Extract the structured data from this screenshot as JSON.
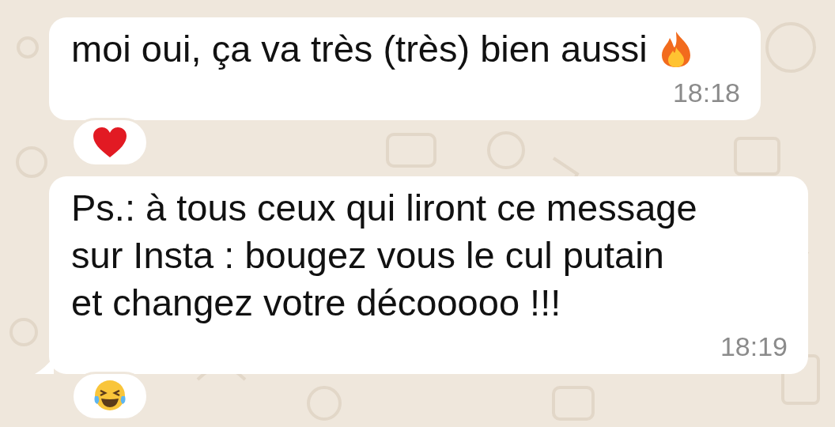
{
  "messages": [
    {
      "kind": "with_emoji",
      "text": "moi oui, ça va très (très) bien aussi",
      "time": "18:18",
      "tail": false,
      "reaction": {
        "kind": "heart"
      }
    },
    {
      "kind": "plain",
      "text": "Ps.: à tous ceux qui liront ce message sur Insta : bougez vous le cul putain et changez votre décooooo !!!",
      "time": "18:19",
      "tail": true,
      "reaction": {
        "kind": "laugh"
      }
    }
  ]
}
